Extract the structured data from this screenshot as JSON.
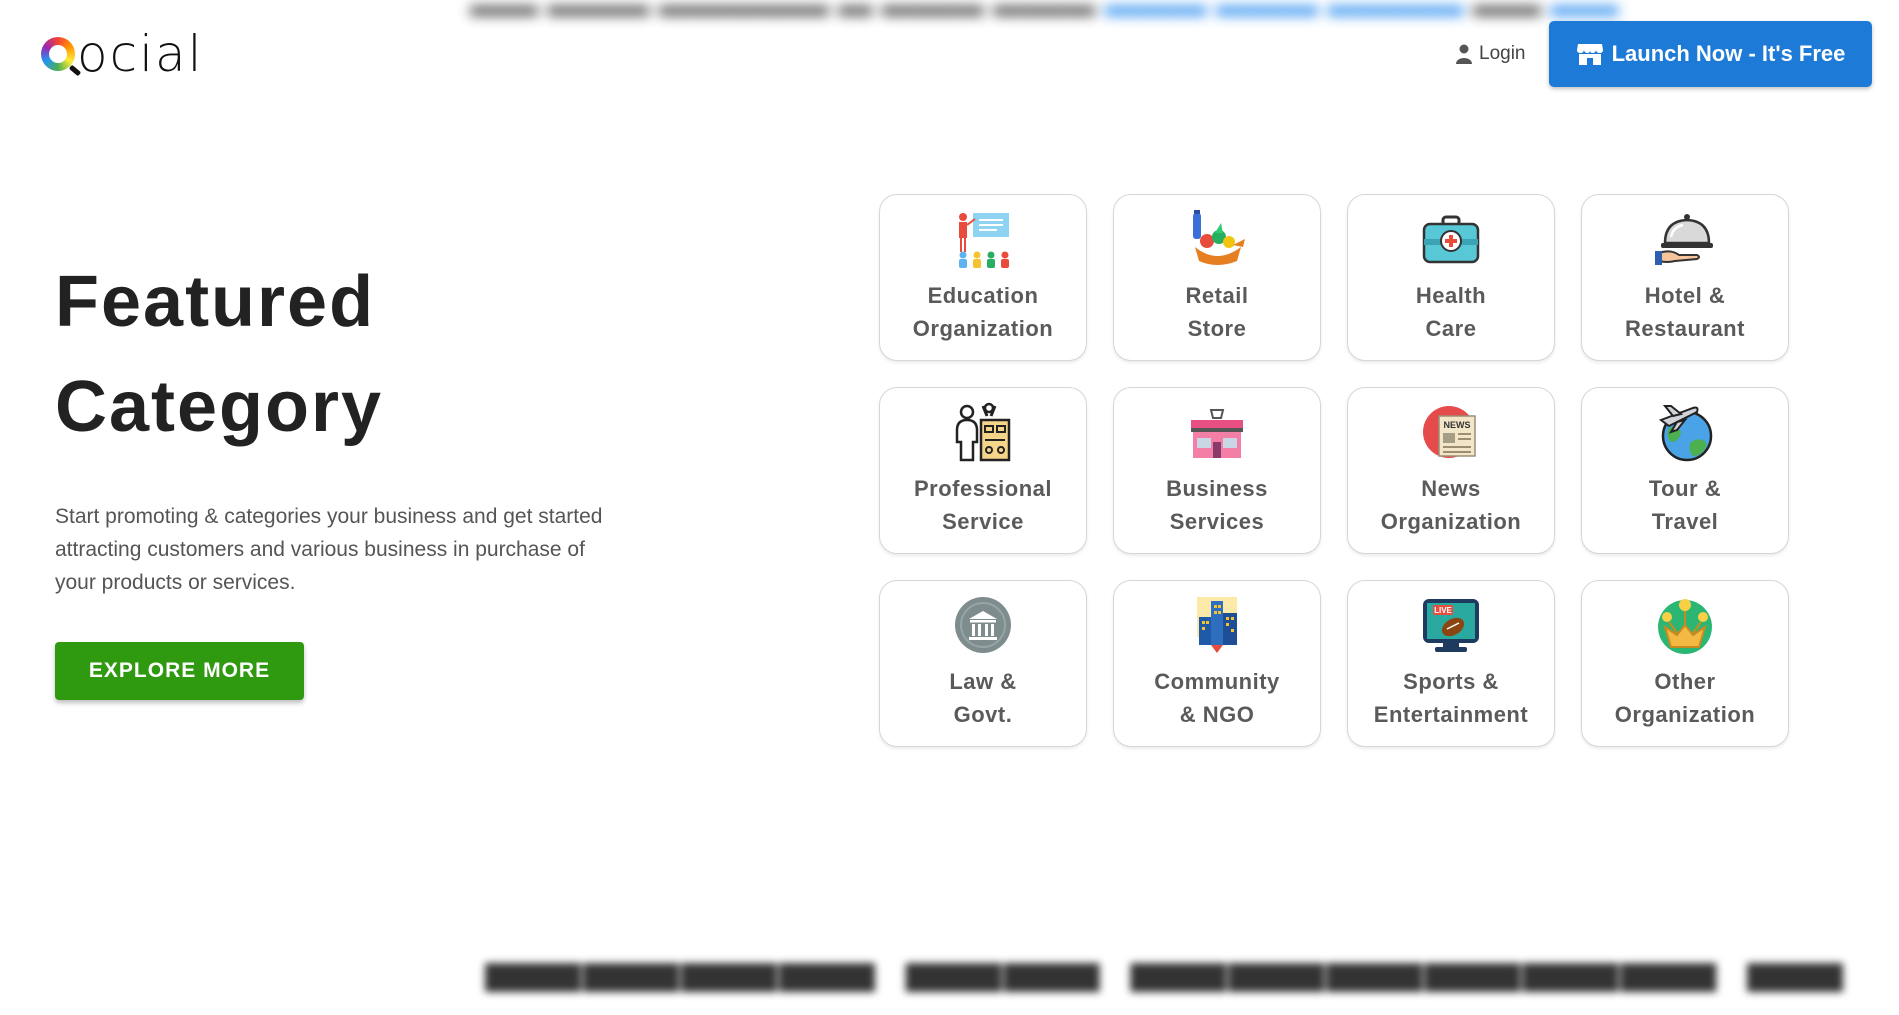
{
  "header": {
    "logo_text": "ocial",
    "login_label": "Login",
    "launch_label": "Launch Now - It's Free",
    "accent_color": "#1e7ad7"
  },
  "hero": {
    "title_line1": "Featured",
    "title_line2": "Category",
    "description": "Start promoting & categories your business and get started attracting customers and various business in purchase of your products or services.",
    "explore_label": "EXPLORE MORE",
    "explore_color": "#2f9a10"
  },
  "categories": [
    {
      "label": "Education\nOrganization",
      "icon": "education-icon"
    },
    {
      "label": "Retail\nStore",
      "icon": "grocery-icon"
    },
    {
      "label": "Health\nCare",
      "icon": "medical-kit-icon"
    },
    {
      "label": "Hotel &\nRestaurant",
      "icon": "cloche-icon"
    },
    {
      "label": "Professional\nService",
      "icon": "professional-icon"
    },
    {
      "label": "Business\nServices",
      "icon": "shop-icon"
    },
    {
      "label": "News\nOrganization",
      "icon": "newspaper-icon"
    },
    {
      "label": "Tour &\nTravel",
      "icon": "globe-plane-icon"
    },
    {
      "label": "Law &\nGovt.",
      "icon": "courthouse-icon"
    },
    {
      "label": "Community\n& NGO",
      "icon": "buildings-icon"
    },
    {
      "label": "Sports &\nEntertainment",
      "icon": "live-tv-icon"
    },
    {
      "label": "Other\nOrganization",
      "icon": "ideas-icon"
    }
  ]
}
